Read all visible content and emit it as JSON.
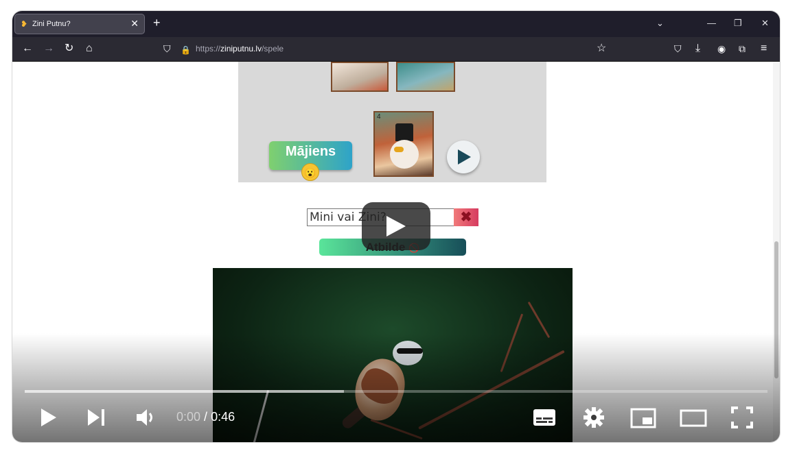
{
  "browser": {
    "tab_title": "Zini Putnu?",
    "tab_favicon": "bird-favicon",
    "url_prefix": "https://",
    "url_host": "ziniputnu.lv",
    "url_path": "/spele"
  },
  "game": {
    "card_number": "4",
    "majiens_label": "Mājiens",
    "emoji": "😮",
    "answer_placeholder": "Mini vai Zini?",
    "clear_symbol": "✖",
    "atbilde_label": "Atbilde",
    "atbilde_icon": "🚫"
  },
  "player": {
    "current_time": "0:00",
    "separator": " / ",
    "duration": "0:46",
    "progress_fraction": 0.0,
    "buffered_fraction": 0.43
  },
  "icons": {
    "back": "←",
    "forward": "→",
    "reload": "↻",
    "home": "⌂",
    "shield": "⛉",
    "lock": "🔒",
    "star": "☆",
    "pocket": "⛉",
    "download": "⤓",
    "account": "◉",
    "extensions": "⧉",
    "menu": "≡",
    "chevron_down": "⌄",
    "minimize": "—",
    "restore": "❐",
    "close": "✕",
    "new_tab": "+",
    "tab_close": "✕"
  }
}
